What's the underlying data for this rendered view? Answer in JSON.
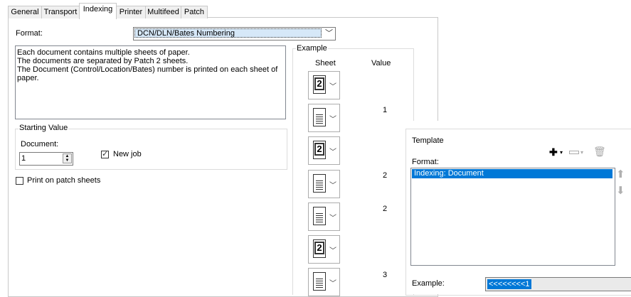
{
  "tabs": [
    "General",
    "Transport",
    "Indexing",
    "Printer",
    "Multifeed",
    "Patch"
  ],
  "active_tab": "Indexing",
  "format": {
    "label": "Format:",
    "value": "DCN/DLN/Bates Numbering"
  },
  "description": [
    "Each document contains multiple sheets of paper.",
    "The documents are separated by Patch 2 sheets.",
    "The Document (Control/Location/Bates) number is printed on each sheet of paper."
  ],
  "starting_value": {
    "title": "Starting Value",
    "document_label": "Document:",
    "document_value": "1",
    "new_job_label": "New job",
    "new_job_checked": true
  },
  "print_on_patch": {
    "label": "Print on patch sheets",
    "checked": false
  },
  "example": {
    "title": "Example",
    "col_sheet": "Sheet",
    "col_value": "Value",
    "rows": [
      {
        "icon": "patch-2-sheet-icon",
        "value": ""
      },
      {
        "icon": "document-sheet-icon",
        "value": "1"
      },
      {
        "icon": "patch-2-sheet-icon",
        "value": ""
      },
      {
        "icon": "document-sheet-icon",
        "value": "2"
      },
      {
        "icon": "document-sheet-icon",
        "value": "2"
      },
      {
        "icon": "patch-2-sheet-icon",
        "value": ""
      },
      {
        "icon": "document-sheet-icon",
        "value": "3"
      }
    ]
  },
  "template": {
    "title": "Template",
    "format_label": "Format:",
    "items": [
      "Indexing: Document"
    ],
    "example_label": "Example:",
    "example_value": "<<<<<<<<1",
    "icons": [
      "add-icon",
      "remove-icon",
      "delete-icon",
      "move-up-icon",
      "move-down-icon"
    ]
  }
}
